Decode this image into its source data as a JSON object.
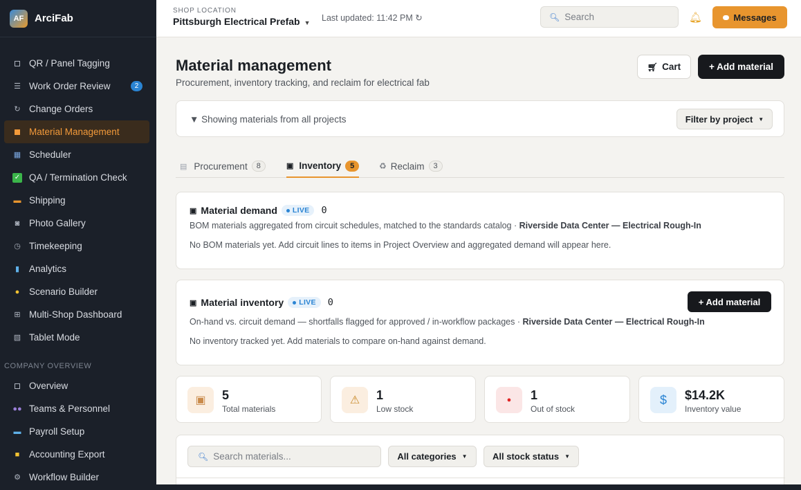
{
  "brand": {
    "logo": "AF",
    "name": "ArciFab"
  },
  "sidebar": {
    "items": [
      {
        "label": "QR / Panel Tagging",
        "icon": "qr-icon"
      },
      {
        "label": "Work Order Review",
        "icon": "list-icon",
        "badge": "2"
      },
      {
        "label": "Change Orders",
        "icon": "refresh-icon"
      },
      {
        "label": "Material Management",
        "icon": "box-icon",
        "active": true
      },
      {
        "label": "Scheduler",
        "icon": "calendar-icon"
      },
      {
        "label": "QA / Termination Check",
        "icon": "check-icon"
      },
      {
        "label": "Shipping",
        "icon": "truck-icon"
      },
      {
        "label": "Photo Gallery",
        "icon": "camera-icon"
      },
      {
        "label": "Timekeeping",
        "icon": "clock-icon"
      },
      {
        "label": "Analytics",
        "icon": "chart-icon"
      },
      {
        "label": "Scenario Builder",
        "icon": "bulb-icon"
      },
      {
        "label": "Multi-Shop Dashboard",
        "icon": "grid-icon"
      },
      {
        "label": "Tablet Mode",
        "icon": "tablet-icon"
      }
    ],
    "section_title": "COMPANY OVERVIEW",
    "company_items": [
      {
        "label": "Overview",
        "icon": "overview-icon"
      },
      {
        "label": "Teams & Personnel",
        "icon": "people-icon"
      },
      {
        "label": "Payroll Setup",
        "icon": "card-icon"
      },
      {
        "label": "Accounting Export",
        "icon": "folder-icon"
      },
      {
        "label": "Workflow Builder",
        "icon": "gear-icon"
      }
    ]
  },
  "topbar": {
    "shop_label": "SHOP LOCATION",
    "shop_name": "Pittsburgh Electrical Prefab",
    "last_updated": "Last updated: 11:42 PM ↻",
    "search_placeholder": "Search",
    "messages_label": "Messages"
  },
  "page": {
    "title": "Material management",
    "subtitle": "Procurement, inventory tracking, and reclaim for electrical fab",
    "cart_label": "Cart",
    "add_material_label": "+ Add material"
  },
  "filter": {
    "text": "▼ Showing materials from all projects",
    "button_label": "Filter by project"
  },
  "tabs": [
    {
      "label": "Procurement",
      "count": "8"
    },
    {
      "label": "Inventory",
      "count": "5",
      "active": true
    },
    {
      "label": "Reclaim",
      "count": "3"
    }
  ],
  "demand": {
    "title": "Material demand",
    "live": "LIVE",
    "count": "0",
    "desc": "BOM materials aggregated from circuit schedules, matched to the standards catalog · ",
    "project": "Riverside Data Center — Electrical Rough-In",
    "empty": "No BOM materials yet. Add circuit lines to items in Project Overview and aggregated demand will appear here."
  },
  "inventory": {
    "title": "Material inventory",
    "live": "LIVE",
    "count": "0",
    "desc": "On-hand vs. circuit demand — shortfalls flagged for approved / in-workflow packages · ",
    "project": "Riverside Data Center — Electrical Rough-In",
    "empty": "No inventory tracked yet. Add materials to compare on-hand against demand.",
    "add_label": "+ Add material"
  },
  "stats": [
    {
      "value": "5",
      "label": "Total materials",
      "icon": "package-icon",
      "color": "#fbeee0"
    },
    {
      "value": "1",
      "label": "Low stock",
      "icon": "warning-icon",
      "color": "#fbeee0"
    },
    {
      "value": "1",
      "label": "Out of stock",
      "icon": "red-dot-icon",
      "color": "#fbe6e6"
    },
    {
      "value": "$14.2K",
      "label": "Inventory value",
      "icon": "dollar-icon",
      "color": "#e3f0fb"
    }
  ],
  "materials_search": {
    "placeholder": "Search materials...",
    "category": "All categories",
    "stock_status": "All stock status"
  }
}
